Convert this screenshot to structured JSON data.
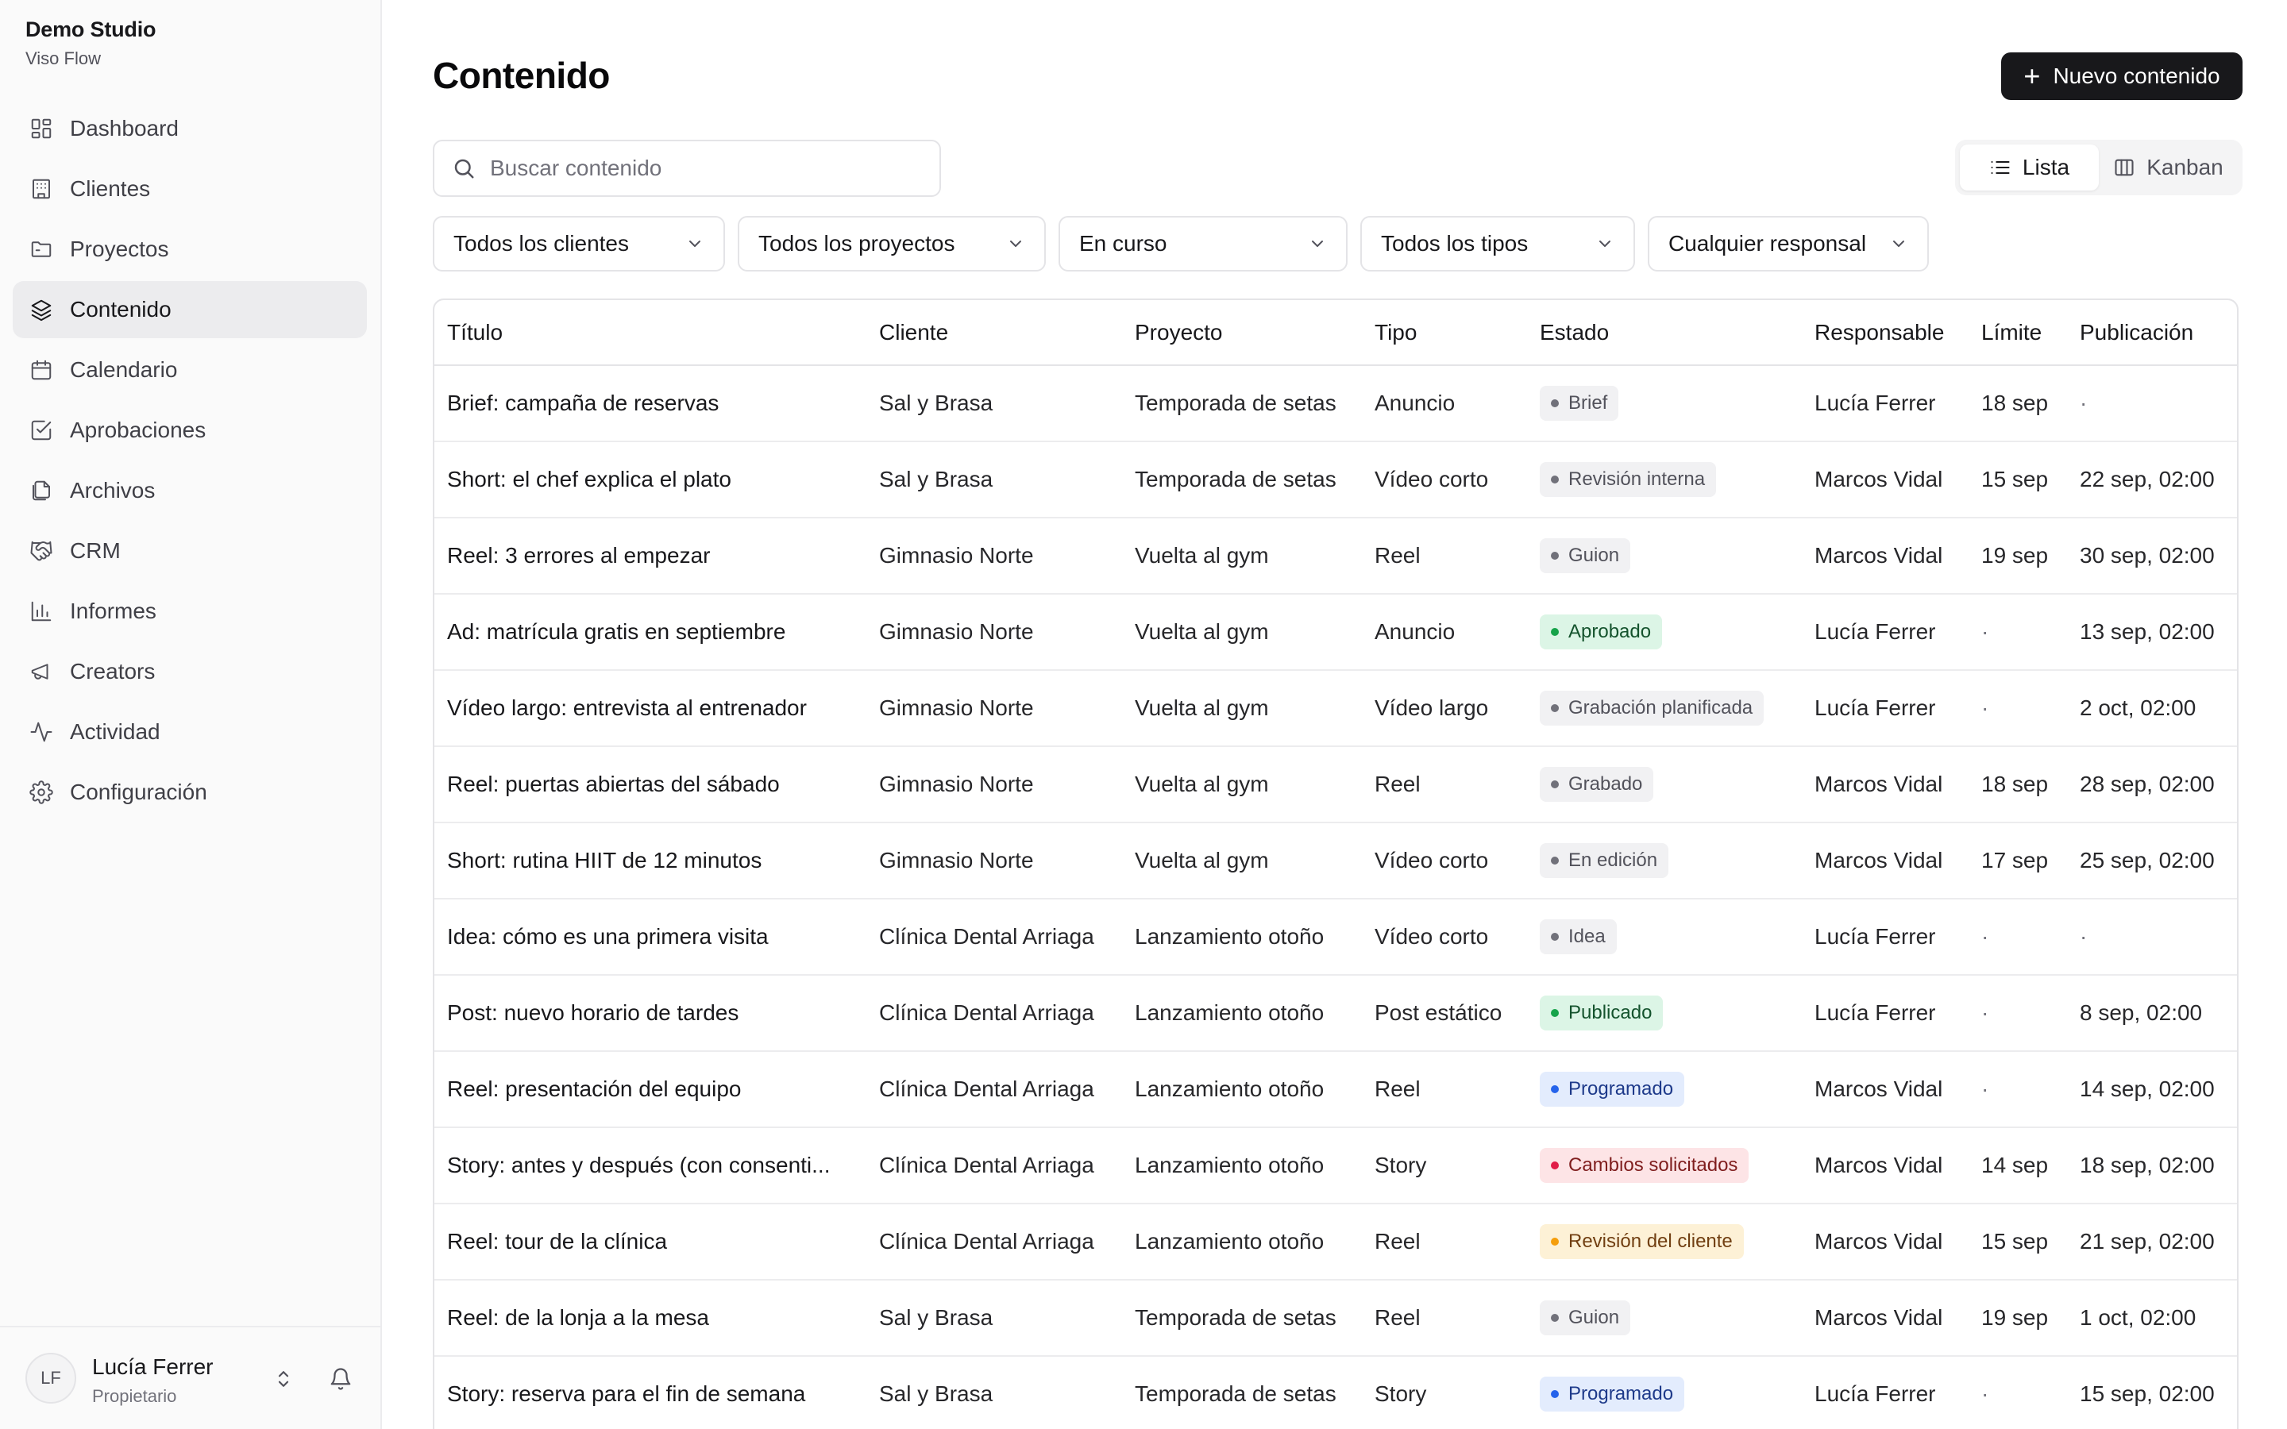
{
  "sidebar": {
    "brand_name": "Demo Studio",
    "brand_sub": "Viso Flow",
    "items": [
      {
        "label": "Dashboard",
        "icon": "dashboard-icon"
      },
      {
        "label": "Clientes",
        "icon": "building-icon"
      },
      {
        "label": "Proyectos",
        "icon": "folder-icon"
      },
      {
        "label": "Contenido",
        "icon": "layers-icon",
        "active": true
      },
      {
        "label": "Calendario",
        "icon": "calendar-icon"
      },
      {
        "label": "Aprobaciones",
        "icon": "check-square-icon"
      },
      {
        "label": "Archivos",
        "icon": "files-icon"
      },
      {
        "label": "CRM",
        "icon": "handshake-icon"
      },
      {
        "label": "Informes",
        "icon": "bar-chart-icon"
      },
      {
        "label": "Creators",
        "icon": "megaphone-icon"
      },
      {
        "label": "Actividad",
        "icon": "activity-icon"
      },
      {
        "label": "Configuración",
        "icon": "gear-icon"
      }
    ],
    "user": {
      "initials": "LF",
      "name": "Lucía Ferrer",
      "role": "Propietario"
    }
  },
  "header": {
    "title": "Contenido",
    "new_button": "Nuevo contenido"
  },
  "search": {
    "placeholder": "Buscar contenido",
    "value": ""
  },
  "view_toggle": {
    "list": "Lista",
    "kanban": "Kanban",
    "selected": "Lista"
  },
  "filters": [
    {
      "label": "Todos los clientes"
    },
    {
      "label": "Todos los proyectos"
    },
    {
      "label": "En curso"
    },
    {
      "label": "Todos los tipos"
    },
    {
      "label": "Cualquier responsal"
    }
  ],
  "status_styles": {
    "neutral": {
      "bg": "#f1f1f3",
      "fg": "#52525b",
      "dot": "#71717a"
    },
    "green": {
      "bg": "#dcf5e6",
      "fg": "#14532d",
      "dot": "#16a34a"
    },
    "blue": {
      "bg": "#e3ecfd",
      "fg": "#1e3a8a",
      "dot": "#2563eb"
    },
    "red": {
      "bg": "#fde4e6",
      "fg": "#7f1d1d",
      "dot": "#e11d48"
    },
    "amber": {
      "bg": "#fdf1d6",
      "fg": "#713f12",
      "dot": "#f59e0b"
    }
  },
  "table": {
    "columns": [
      "Título",
      "Cliente",
      "Proyecto",
      "Tipo",
      "Estado",
      "Responsable",
      "Límite",
      "Publicación"
    ],
    "rows": [
      {
        "title": "Brief: campaña de reservas",
        "client": "Sal y Brasa",
        "project": "Temporada de setas",
        "type": "Anuncio",
        "status": "Brief",
        "tone": "neutral",
        "owner": "Lucía Ferrer",
        "limit": "18 sep",
        "publish": "·"
      },
      {
        "title": "Short: el chef explica el plato",
        "client": "Sal y Brasa",
        "project": "Temporada de setas",
        "type": "Vídeo corto",
        "status": "Revisión interna",
        "tone": "neutral",
        "owner": "Marcos Vidal",
        "limit": "15 sep",
        "publish": "22 sep, 02:00"
      },
      {
        "title": "Reel: 3 errores al empezar",
        "client": "Gimnasio Norte",
        "project": "Vuelta al gym",
        "type": "Reel",
        "status": "Guion",
        "tone": "neutral",
        "owner": "Marcos Vidal",
        "limit": "19 sep",
        "publish": "30 sep, 02:00"
      },
      {
        "title": "Ad: matrícula gratis en septiembre",
        "client": "Gimnasio Norte",
        "project": "Vuelta al gym",
        "type": "Anuncio",
        "status": "Aprobado",
        "tone": "green",
        "owner": "Lucía Ferrer",
        "limit": "·",
        "publish": "13 sep, 02:00"
      },
      {
        "title": "Vídeo largo: entrevista al entrenador",
        "client": "Gimnasio Norte",
        "project": "Vuelta al gym",
        "type": "Vídeo largo",
        "status": "Grabación planificada",
        "tone": "neutral",
        "owner": "Lucía Ferrer",
        "limit": "·",
        "publish": "2 oct, 02:00"
      },
      {
        "title": "Reel: puertas abiertas del sábado",
        "client": "Gimnasio Norte",
        "project": "Vuelta al gym",
        "type": "Reel",
        "status": "Grabado",
        "tone": "neutral",
        "owner": "Marcos Vidal",
        "limit": "18 sep",
        "publish": "28 sep, 02:00"
      },
      {
        "title": "Short: rutina HIIT de 12 minutos",
        "client": "Gimnasio Norte",
        "project": "Vuelta al gym",
        "type": "Vídeo corto",
        "status": "En edición",
        "tone": "neutral",
        "owner": "Marcos Vidal",
        "limit": "17 sep",
        "publish": "25 sep, 02:00"
      },
      {
        "title": "Idea: cómo es una primera visita",
        "client": "Clínica Dental Arriaga",
        "project": "Lanzamiento otoño",
        "type": "Vídeo corto",
        "status": "Idea",
        "tone": "neutral",
        "owner": "Lucía Ferrer",
        "limit": "·",
        "publish": "·"
      },
      {
        "title": "Post: nuevo horario de tardes",
        "client": "Clínica Dental Arriaga",
        "project": "Lanzamiento otoño",
        "type": "Post estático",
        "status": "Publicado",
        "tone": "green",
        "owner": "Lucía Ferrer",
        "limit": "·",
        "publish": "8 sep, 02:00"
      },
      {
        "title": "Reel: presentación del equipo",
        "client": "Clínica Dental Arriaga",
        "project": "Lanzamiento otoño",
        "type": "Reel",
        "status": "Programado",
        "tone": "blue",
        "owner": "Marcos Vidal",
        "limit": "·",
        "publish": "14 sep, 02:00"
      },
      {
        "title": "Story: antes y después (con consenti...",
        "client": "Clínica Dental Arriaga",
        "project": "Lanzamiento otoño",
        "type": "Story",
        "status": "Cambios solicitados",
        "tone": "red",
        "owner": "Marcos Vidal",
        "limit": "14 sep",
        "publish": "18 sep, 02:00"
      },
      {
        "title": "Reel: tour de la clínica",
        "client": "Clínica Dental Arriaga",
        "project": "Lanzamiento otoño",
        "type": "Reel",
        "status": "Revisión del cliente",
        "tone": "amber",
        "owner": "Marcos Vidal",
        "limit": "15 sep",
        "publish": "21 sep, 02:00"
      },
      {
        "title": "Reel: de la lonja a la mesa",
        "client": "Sal y Brasa",
        "project": "Temporada de setas",
        "type": "Reel",
        "status": "Guion",
        "tone": "neutral",
        "owner": "Marcos Vidal",
        "limit": "19 sep",
        "publish": "1 oct, 02:00"
      },
      {
        "title": "Story: reserva para el fin de semana",
        "client": "Sal y Brasa",
        "project": "Temporada de setas",
        "type": "Story",
        "status": "Programado",
        "tone": "blue",
        "owner": "Lucía Ferrer",
        "limit": "·",
        "publish": "15 sep, 02:00"
      }
    ]
  }
}
